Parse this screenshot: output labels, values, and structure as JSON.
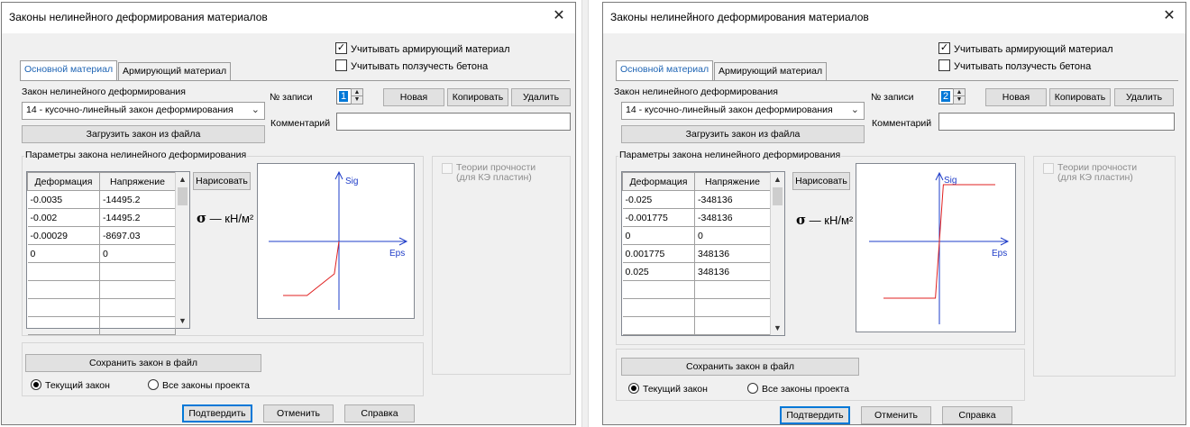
{
  "dialogs": [
    {
      "title": "Законы нелинейного деформирования материалов",
      "close_glyph": "✕",
      "checkbox_reinforcement": {
        "label": "Учитывать армирующий материал",
        "checked": true
      },
      "checkbox_creep": {
        "label": "Учитывать ползучесть бетона",
        "checked": false
      },
      "tabs": [
        "Основной материал",
        "Армирующий материал"
      ],
      "law_label": "Закон нелинейного деформирования",
      "law_selected": "14 - кусочно-линейный закон деформирования",
      "load_button": "Загрузить закон из файла",
      "record_label": "№ записи",
      "record_value": "1",
      "new_button": "Новая",
      "copy_button": "Копировать",
      "delete_button": "Удалить",
      "comment_label": "Комментарий",
      "comment_value": "",
      "params_group": "Параметры закона нелинейного деформирования",
      "columns": [
        "Деформация",
        "Напряжение"
      ],
      "rows": [
        [
          "-0.0035",
          "-14495.2"
        ],
        [
          "-0.002",
          "-14495.2"
        ],
        [
          "-0.00029",
          "-8697.03"
        ],
        [
          "0",
          "0"
        ],
        [
          "",
          ""
        ],
        [
          "",
          ""
        ],
        [
          "",
          ""
        ],
        [
          "",
          ""
        ]
      ],
      "draw_button": "Нарисовать",
      "sigma_symbol": "σ",
      "sigma_units": " — кН/м²",
      "plot": {
        "y_label": "Sig",
        "x_label": "Eps",
        "line_color": "#e02020",
        "axis_color": "#1e3cc8"
      },
      "strength_theory_line1": "Теории прочности",
      "strength_theory_line2": "(для КЭ пластин)",
      "save_button": "Сохранить закон в файл",
      "radio_current": "Текущий закон",
      "radio_all": "Все законы проекта",
      "ok_button": "Подтвердить",
      "cancel_button": "Отменить",
      "help_button": "Справка"
    },
    {
      "title": "Законы нелинейного деформирования материалов",
      "close_glyph": "✕",
      "checkbox_reinforcement": {
        "label": "Учитывать армирующий материал",
        "checked": true
      },
      "checkbox_creep": {
        "label": "Учитывать ползучесть бетона",
        "checked": false
      },
      "tabs": [
        "Основной материал",
        "Армирующий материал"
      ],
      "law_label": "Закон нелинейного деформирования",
      "law_selected": "14 - кусочно-линейный закон деформирования",
      "load_button": "Загрузить закон из файла",
      "record_label": "№ записи",
      "record_value": "2",
      "new_button": "Новая",
      "copy_button": "Копировать",
      "delete_button": "Удалить",
      "comment_label": "Комментарий",
      "comment_value": "",
      "params_group": "Параметры закона нелинейного деформирования",
      "columns": [
        "Деформация",
        "Напряжение"
      ],
      "rows": [
        [
          "-0.025",
          "-348136"
        ],
        [
          "-0.001775",
          "-348136"
        ],
        [
          "0",
          "0"
        ],
        [
          "0.001775",
          "348136"
        ],
        [
          "0.025",
          "348136"
        ],
        [
          "",
          ""
        ],
        [
          "",
          ""
        ],
        [
          "",
          ""
        ]
      ],
      "draw_button": "Нарисовать",
      "sigma_symbol": "σ",
      "sigma_units": " — кН/м²",
      "plot": {
        "y_label": "Sig",
        "x_label": "Eps",
        "line_color": "#e02020",
        "axis_color": "#1e3cc8"
      },
      "strength_theory_line1": "Теории прочности",
      "strength_theory_line2": "(для КЭ пластин)",
      "save_button": "Сохранить закон в файл",
      "radio_current": "Текущий закон",
      "radio_all": "Все законы проекта",
      "ok_button": "Подтвердить",
      "cancel_button": "Отменить",
      "help_button": "Справка"
    }
  ]
}
